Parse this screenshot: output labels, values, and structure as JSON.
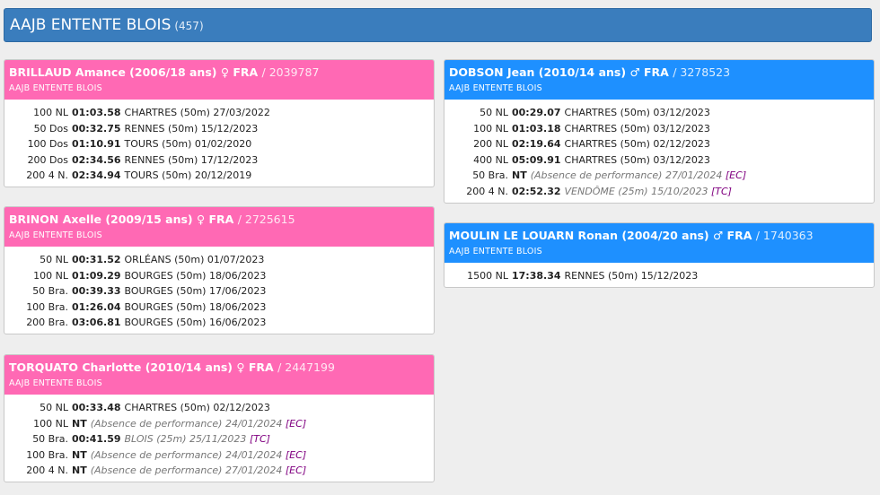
{
  "header": {
    "title": "AAJB ENTENTE BLOIS",
    "count": "(457)"
  },
  "swimmers": [
    {
      "name": "BRILLAUD Amance (2006/18 ans) ♀ FRA",
      "license": "/ 2039787",
      "club": "AAJB ENTENTE BLOIS",
      "rows": [
        {
          "event": "100 NL",
          "time": "01:03.58",
          "place": "CHARTRES (50m) 27/03/2022",
          "italic": false,
          "tag": ""
        },
        {
          "event": "50 Dos",
          "time": "00:32.75",
          "place": "RENNES (50m) 15/12/2023",
          "italic": false,
          "tag": ""
        },
        {
          "event": "100 Dos",
          "time": "01:10.91",
          "place": "TOURS (50m) 01/02/2020",
          "italic": false,
          "tag": ""
        },
        {
          "event": "200 Dos",
          "time": "02:34.56",
          "place": "RENNES (50m) 17/12/2023",
          "italic": false,
          "tag": ""
        },
        {
          "event": "200 4 N.",
          "time": "02:34.94",
          "place": "TOURS (50m) 20/12/2019",
          "italic": false,
          "tag": ""
        }
      ]
    },
    {
      "name": "BRINON Axelle (2009/15 ans) ♀ FRA",
      "license": "/ 2725615",
      "club": "AAJB ENTENTE BLOIS",
      "rows": [
        {
          "event": "50 NL",
          "time": "00:31.52",
          "place": "ORLÉANS (50m) 01/07/2023",
          "italic": false,
          "tag": ""
        },
        {
          "event": "100 NL",
          "time": "01:09.29",
          "place": "BOURGES (50m) 18/06/2023",
          "italic": false,
          "tag": ""
        },
        {
          "event": "50 Bra.",
          "time": "00:39.33",
          "place": "BOURGES (50m) 17/06/2023",
          "italic": false,
          "tag": ""
        },
        {
          "event": "100 Bra.",
          "time": "01:26.04",
          "place": "BOURGES (50m) 18/06/2023",
          "italic": false,
          "tag": ""
        },
        {
          "event": "200 Bra.",
          "time": "03:06.81",
          "place": "BOURGES (50m) 16/06/2023",
          "italic": false,
          "tag": ""
        }
      ]
    },
    {
      "name": "TORQUATO Charlotte (2010/14 ans) ♀ FRA",
      "license": "/ 2447199",
      "club": "AAJB ENTENTE BLOIS",
      "rows": [
        {
          "event": "50 NL",
          "time": "00:33.48",
          "place": "CHARTRES (50m) 02/12/2023",
          "italic": false,
          "tag": ""
        },
        {
          "event": "100 NL",
          "time": "NT",
          "place": "(Absence de performance) 24/01/2024",
          "italic": true,
          "tag": "[EC]"
        },
        {
          "event": "50 Bra.",
          "time": "00:41.59",
          "place": "BLOIS (25m) 25/11/2023",
          "italic": true,
          "tag": "[TC]"
        },
        {
          "event": "100 Bra.",
          "time": "NT",
          "place": "(Absence de performance) 24/01/2024",
          "italic": true,
          "tag": "[EC]"
        },
        {
          "event": "200 4 N.",
          "time": "NT",
          "place": "(Absence de performance) 27/01/2024",
          "italic": true,
          "tag": "[EC]"
        }
      ]
    },
    {
      "name": "DOBSON Jean (2010/14 ans) ♂ FRA",
      "license": "/ 3278523",
      "club": "AAJB ENTENTE BLOIS",
      "rows": [
        {
          "event": "50 NL",
          "time": "00:29.07",
          "place": "CHARTRES (50m) 03/12/2023",
          "italic": false,
          "tag": ""
        },
        {
          "event": "100 NL",
          "time": "01:03.18",
          "place": "CHARTRES (50m) 03/12/2023",
          "italic": false,
          "tag": ""
        },
        {
          "event": "200 NL",
          "time": "02:19.64",
          "place": "CHARTRES (50m) 02/12/2023",
          "italic": false,
          "tag": ""
        },
        {
          "event": "400 NL",
          "time": "05:09.91",
          "place": "CHARTRES (50m) 03/12/2023",
          "italic": false,
          "tag": ""
        },
        {
          "event": "50 Bra.",
          "time": "NT",
          "place": "(Absence de performance) 27/01/2024",
          "italic": true,
          "tag": "[EC]"
        },
        {
          "event": "200 4 N.",
          "time": "02:52.32",
          "place": "VENDÔME (25m) 15/10/2023",
          "italic": true,
          "tag": "[TC]"
        }
      ]
    },
    {
      "name": "MOULIN LE LOUARN Ronan (2004/20 ans) ♂ FRA",
      "license": "/ 1740363",
      "club": "AAJB ENTENTE BLOIS",
      "rows": [
        {
          "event": "1500 NL",
          "time": "17:38.34",
          "place": "RENNES (50m) 15/12/2023",
          "italic": false,
          "tag": ""
        }
      ]
    }
  ]
}
